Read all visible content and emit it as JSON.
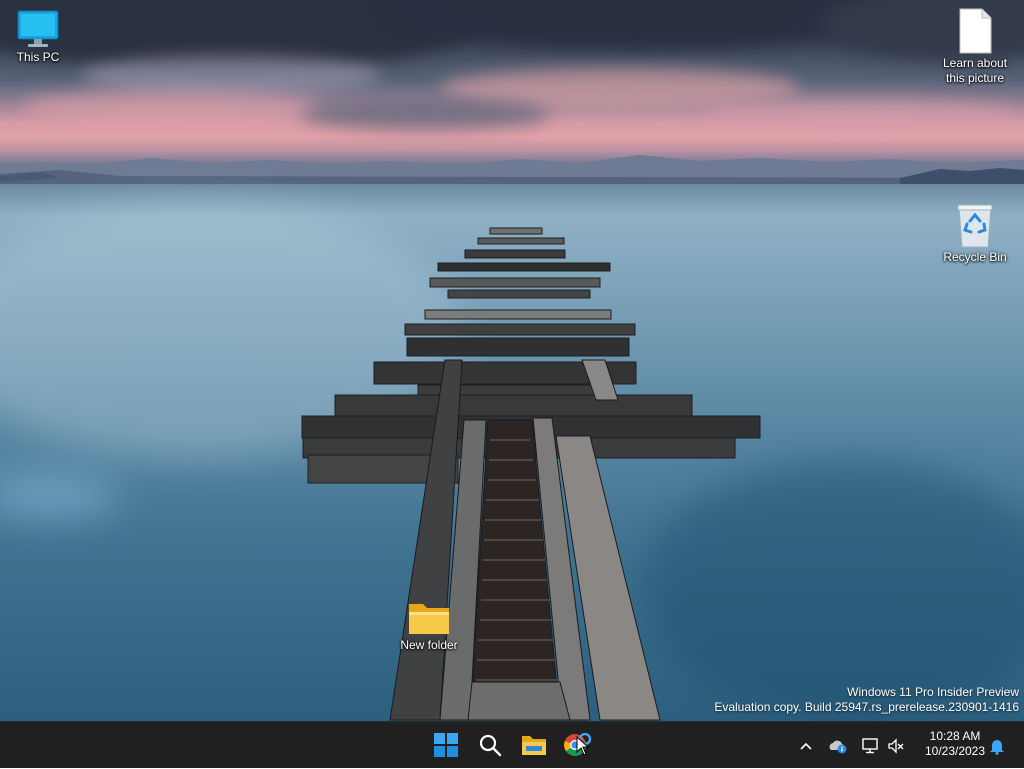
{
  "desktop": {
    "icons": [
      {
        "label": "This PC",
        "icon": "computer-monitor-icon"
      },
      {
        "label": "Learn about this picture",
        "icon": "document-icon"
      },
      {
        "label": "Recycle Bin",
        "icon": "recycle-bin-icon"
      },
      {
        "label": "New folder",
        "icon": "folder-icon"
      }
    ],
    "watermark": {
      "line1": "Windows 11 Pro Insider Preview",
      "line2": "Evaluation copy. Build 25947.rs_prerelease.230901-1416"
    }
  },
  "taskbar": {
    "pinned": [
      {
        "name": "Start",
        "icon": "windows-logo-icon"
      },
      {
        "name": "Search",
        "icon": "search-icon"
      },
      {
        "name": "File Explorer",
        "icon": "folder-icon"
      },
      {
        "name": "Chrome",
        "icon": "chrome-icon"
      }
    ],
    "tray": {
      "icons": [
        "chevron-up-icon",
        "onedrive-icon",
        "network-icon",
        "volume-muted-icon",
        "notification-bell-icon"
      ],
      "time": "10:28 AM",
      "date": "10/23/2023"
    },
    "background": "#202020"
  },
  "colors": {
    "accent": "#0078d4",
    "folder_yellow": "#f7c948"
  }
}
